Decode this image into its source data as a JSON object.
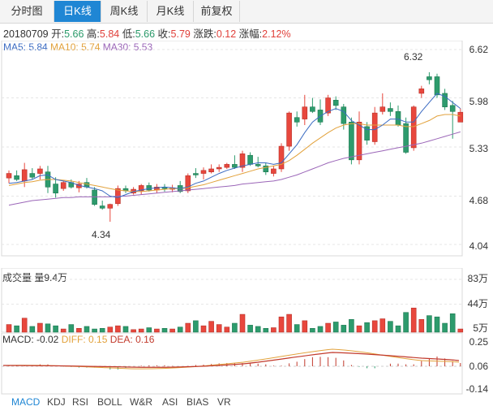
{
  "tabs": [
    {
      "label": "分时图",
      "active": false
    },
    {
      "label": "日K线",
      "active": true
    },
    {
      "label": "周K线",
      "active": false
    },
    {
      "label": "月K线",
      "active": false
    },
    {
      "label": "前复权",
      "active": false
    }
  ],
  "info": {
    "date": "20180709",
    "open_label": "开:",
    "open": "5.66",
    "high_label": "高:",
    "high": "5.84",
    "low_label": "低:",
    "low": "5.66",
    "close_label": "收:",
    "close": "5.79",
    "change_label": "涨跌:",
    "change": "0.12",
    "pct_label": "涨幅:",
    "pct": "2.12%"
  },
  "ma": {
    "ma5": "MA5: 5.84",
    "ma10": "MA10: 5.74",
    "ma30": "MA30: 5.53"
  },
  "price_axis": [
    "6.62",
    "5.98",
    "5.33",
    "4.68",
    "4.04"
  ],
  "max_label": "6.32",
  "min_label": "4.34",
  "volume": {
    "title": "成交量",
    "amount": "量9.4万",
    "axis": [
      "83万",
      "44万",
      "5万"
    ]
  },
  "macd": {
    "label": "MACD: -0.02",
    "diff": "DIFF: 0.15",
    "dea": "DEA: 0.16",
    "axis": [
      "0.25",
      "0.06",
      "-0.14"
    ]
  },
  "bottom_tabs": [
    {
      "label": "MACD",
      "active": true
    },
    {
      "label": "KDJ",
      "active": false
    },
    {
      "label": "RSI",
      "active": false
    },
    {
      "label": "BOLL",
      "active": false
    },
    {
      "label": "W&R",
      "active": false
    },
    {
      "label": "ASI",
      "active": false
    },
    {
      "label": "BIAS",
      "active": false
    },
    {
      "label": "VR",
      "active": false
    }
  ],
  "colors": {
    "up": "#e8473d",
    "down": "#2d9b6d",
    "ma5": "#3b6bc2",
    "ma10": "#e2a23c",
    "ma30": "#9b66b8",
    "diff": "#e2a23c",
    "dea": "#c23a2c",
    "accent": "#1f86d4"
  },
  "chart_data": {
    "type": "candlestick",
    "price_range": [
      4.04,
      6.62
    ],
    "candles": [
      {
        "o": 4.92,
        "h": 5.02,
        "l": 4.85,
        "c": 4.98
      },
      {
        "o": 4.95,
        "h": 5.02,
        "l": 4.88,
        "c": 4.9
      },
      {
        "o": 4.88,
        "h": 5.12,
        "l": 4.8,
        "c": 5.03
      },
      {
        "o": 4.98,
        "h": 5.05,
        "l": 4.9,
        "c": 4.93
      },
      {
        "o": 4.98,
        "h": 5.08,
        "l": 4.9,
        "c": 5.04
      },
      {
        "o": 5.0,
        "h": 5.08,
        "l": 4.72,
        "c": 4.8
      },
      {
        "o": 4.84,
        "h": 4.93,
        "l": 4.66,
        "c": 4.72
      },
      {
        "o": 4.78,
        "h": 4.88,
        "l": 4.75,
        "c": 4.86
      },
      {
        "o": 4.86,
        "h": 4.9,
        "l": 4.78,
        "c": 4.8
      },
      {
        "o": 4.79,
        "h": 4.88,
        "l": 4.73,
        "c": 4.84
      },
      {
        "o": 4.86,
        "h": 4.92,
        "l": 4.78,
        "c": 4.8
      },
      {
        "o": 4.76,
        "h": 4.8,
        "l": 4.55,
        "c": 4.57
      },
      {
        "o": 4.55,
        "h": 4.62,
        "l": 4.5,
        "c": 4.52
      },
      {
        "o": 4.52,
        "h": 4.58,
        "l": 4.34,
        "c": 4.57
      },
      {
        "o": 4.58,
        "h": 4.82,
        "l": 4.55,
        "c": 4.78
      },
      {
        "o": 4.78,
        "h": 4.82,
        "l": 4.72,
        "c": 4.75
      },
      {
        "o": 4.72,
        "h": 4.8,
        "l": 4.7,
        "c": 4.77
      },
      {
        "o": 4.75,
        "h": 4.84,
        "l": 4.7,
        "c": 4.82
      },
      {
        "o": 4.82,
        "h": 4.86,
        "l": 4.74,
        "c": 4.76
      },
      {
        "o": 4.76,
        "h": 4.84,
        "l": 4.72,
        "c": 4.8
      },
      {
        "o": 4.8,
        "h": 4.84,
        "l": 4.74,
        "c": 4.78
      },
      {
        "o": 4.77,
        "h": 4.83,
        "l": 4.73,
        "c": 4.79
      },
      {
        "o": 4.82,
        "h": 4.88,
        "l": 4.72,
        "c": 4.74
      },
      {
        "o": 4.75,
        "h": 4.98,
        "l": 4.72,
        "c": 4.95
      },
      {
        "o": 4.98,
        "h": 5.05,
        "l": 4.92,
        "c": 4.96
      },
      {
        "o": 4.98,
        "h": 5.06,
        "l": 4.9,
        "c": 5.02
      },
      {
        "o": 5.0,
        "h": 5.1,
        "l": 4.98,
        "c": 5.04
      },
      {
        "o": 5.04,
        "h": 5.1,
        "l": 5.0,
        "c": 5.06
      },
      {
        "o": 5.06,
        "h": 5.12,
        "l": 5.04,
        "c": 5.1
      },
      {
        "o": 5.1,
        "h": 5.22,
        "l": 5.04,
        "c": 5.06
      },
      {
        "o": 5.06,
        "h": 5.28,
        "l": 5.0,
        "c": 5.24
      },
      {
        "o": 5.22,
        "h": 5.26,
        "l": 5.08,
        "c": 5.1
      },
      {
        "o": 5.1,
        "h": 5.2,
        "l": 5.06,
        "c": 5.08
      },
      {
        "o": 5.08,
        "h": 5.12,
        "l": 4.96,
        "c": 5.0
      },
      {
        "o": 4.98,
        "h": 5.08,
        "l": 4.94,
        "c": 5.04
      },
      {
        "o": 5.04,
        "h": 5.38,
        "l": 5.0,
        "c": 5.34
      },
      {
        "o": 5.34,
        "h": 5.8,
        "l": 5.28,
        "c": 5.78
      },
      {
        "o": 5.72,
        "h": 5.8,
        "l": 5.6,
        "c": 5.66
      },
      {
        "o": 5.7,
        "h": 6.02,
        "l": 5.62,
        "c": 5.86
      },
      {
        "o": 5.86,
        "h": 5.98,
        "l": 5.78,
        "c": 5.8
      },
      {
        "o": 5.82,
        "h": 5.96,
        "l": 5.62,
        "c": 5.66
      },
      {
        "o": 5.78,
        "h": 6.02,
        "l": 5.74,
        "c": 5.98
      },
      {
        "o": 5.95,
        "h": 6.0,
        "l": 5.82,
        "c": 5.88
      },
      {
        "o": 5.86,
        "h": 5.9,
        "l": 5.56,
        "c": 5.64
      },
      {
        "o": 5.66,
        "h": 5.72,
        "l": 5.1,
        "c": 5.16
      },
      {
        "o": 5.16,
        "h": 5.8,
        "l": 5.1,
        "c": 5.66
      },
      {
        "o": 5.6,
        "h": 5.66,
        "l": 5.36,
        "c": 5.42
      },
      {
        "o": 5.4,
        "h": 5.86,
        "l": 5.36,
        "c": 5.78
      },
      {
        "o": 5.8,
        "h": 6.04,
        "l": 5.76,
        "c": 5.86
      },
      {
        "o": 5.84,
        "h": 5.92,
        "l": 5.74,
        "c": 5.8
      },
      {
        "o": 5.8,
        "h": 5.88,
        "l": 5.6,
        "c": 5.62
      },
      {
        "o": 5.64,
        "h": 5.72,
        "l": 5.24,
        "c": 5.26
      },
      {
        "o": 5.32,
        "h": 5.88,
        "l": 5.28,
        "c": 5.86
      },
      {
        "o": 6.04,
        "h": 6.14,
        "l": 5.98,
        "c": 6.1
      },
      {
        "o": 6.26,
        "h": 6.32,
        "l": 6.16,
        "c": 6.22
      },
      {
        "o": 6.26,
        "h": 6.3,
        "l": 5.98,
        "c": 6.02
      },
      {
        "o": 6.04,
        "h": 6.1,
        "l": 5.82,
        "c": 5.86
      },
      {
        "o": 5.88,
        "h": 5.94,
        "l": 5.44,
        "c": 5.8
      },
      {
        "o": 5.66,
        "h": 5.84,
        "l": 5.66,
        "c": 5.79
      }
    ],
    "ma5": [
      4.85,
      4.86,
      4.88,
      4.9,
      4.95,
      4.96,
      4.9,
      4.88,
      4.86,
      4.82,
      4.8,
      4.78,
      4.75,
      4.68,
      4.66,
      4.7,
      4.74,
      4.76,
      4.78,
      4.79,
      4.8,
      4.79,
      4.78,
      4.8,
      4.85,
      4.88,
      4.93,
      4.98,
      5.02,
      5.05,
      5.08,
      5.1,
      5.12,
      5.12,
      5.1,
      5.12,
      5.24,
      5.36,
      5.52,
      5.66,
      5.74,
      5.8,
      5.84,
      5.8,
      5.68,
      5.62,
      5.56,
      5.56,
      5.62,
      5.7,
      5.7,
      5.66,
      5.66,
      5.8,
      5.92,
      6.04,
      6.0,
      5.92,
      5.84
    ],
    "ma10": [
      4.82,
      4.84,
      4.86,
      4.87,
      4.89,
      4.9,
      4.9,
      4.89,
      4.88,
      4.86,
      4.84,
      4.82,
      4.8,
      4.78,
      4.76,
      4.75,
      4.74,
      4.74,
      4.75,
      4.76,
      4.77,
      4.78,
      4.78,
      4.79,
      4.81,
      4.83,
      4.86,
      4.89,
      4.92,
      4.95,
      4.98,
      5.01,
      5.04,
      5.06,
      5.08,
      5.1,
      5.15,
      5.22,
      5.3,
      5.38,
      5.45,
      5.52,
      5.58,
      5.62,
      5.64,
      5.64,
      5.62,
      5.62,
      5.62,
      5.62,
      5.62,
      5.6,
      5.6,
      5.64,
      5.68,
      5.74,
      5.76,
      5.76,
      5.74
    ],
    "ma30": [
      4.56,
      4.58,
      4.6,
      4.62,
      4.63,
      4.64,
      4.65,
      4.66,
      4.66,
      4.67,
      4.67,
      4.67,
      4.67,
      4.67,
      4.68,
      4.68,
      4.69,
      4.7,
      4.71,
      4.72,
      4.73,
      4.74,
      4.75,
      4.76,
      4.77,
      4.78,
      4.79,
      4.8,
      4.81,
      4.82,
      4.84,
      4.85,
      4.86,
      4.87,
      4.88,
      4.9,
      4.93,
      4.96,
      5.0,
      5.04,
      5.08,
      5.12,
      5.15,
      5.18,
      5.2,
      5.22,
      5.24,
      5.26,
      5.28,
      5.3,
      5.32,
      5.34,
      5.36,
      5.38,
      5.41,
      5.44,
      5.47,
      5.5,
      5.53
    ],
    "volume_range": [
      0,
      83
    ],
    "volume": [
      12,
      10,
      22,
      9,
      14,
      13,
      10,
      5,
      12,
      6,
      9,
      5,
      6,
      8,
      10,
      9,
      4,
      5,
      7,
      5,
      6,
      5,
      8,
      14,
      18,
      10,
      17,
      12,
      8,
      14,
      28,
      11,
      9,
      6,
      7,
      24,
      28,
      12,
      18,
      6,
      9,
      14,
      16,
      11,
      20,
      10,
      15,
      18,
      21,
      17,
      10,
      31,
      38,
      20,
      26,
      24,
      14,
      29,
      5
    ]
  }
}
